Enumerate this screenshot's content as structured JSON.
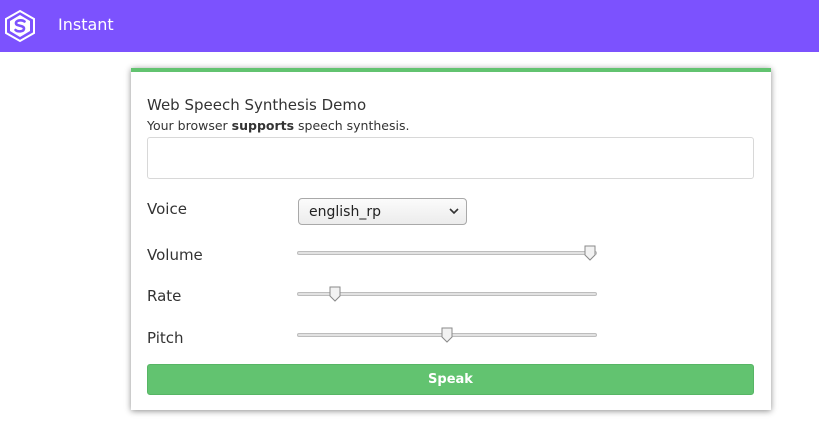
{
  "topbar": {
    "app_title": "Instant",
    "logo_icon": "hexagon-s-logo-icon",
    "background": "#7c52fe"
  },
  "card": {
    "accent_color": "#62c370",
    "title": "Web Speech Synthesis Demo",
    "subtitle_prefix": "Your browser ",
    "subtitle_bold": "supports",
    "subtitle_suffix": " speech synthesis.",
    "text_input": {
      "value": "",
      "placeholder": ""
    },
    "voice": {
      "label": "Voice",
      "selected": "english_rp",
      "icon": "chevron-down-icon"
    },
    "volume": {
      "label": "Volume",
      "level": 1.0
    },
    "rate": {
      "label": "Rate",
      "level": 0.11
    },
    "pitch": {
      "label": "Pitch",
      "level": 0.5
    },
    "speak_label": "Speak"
  }
}
